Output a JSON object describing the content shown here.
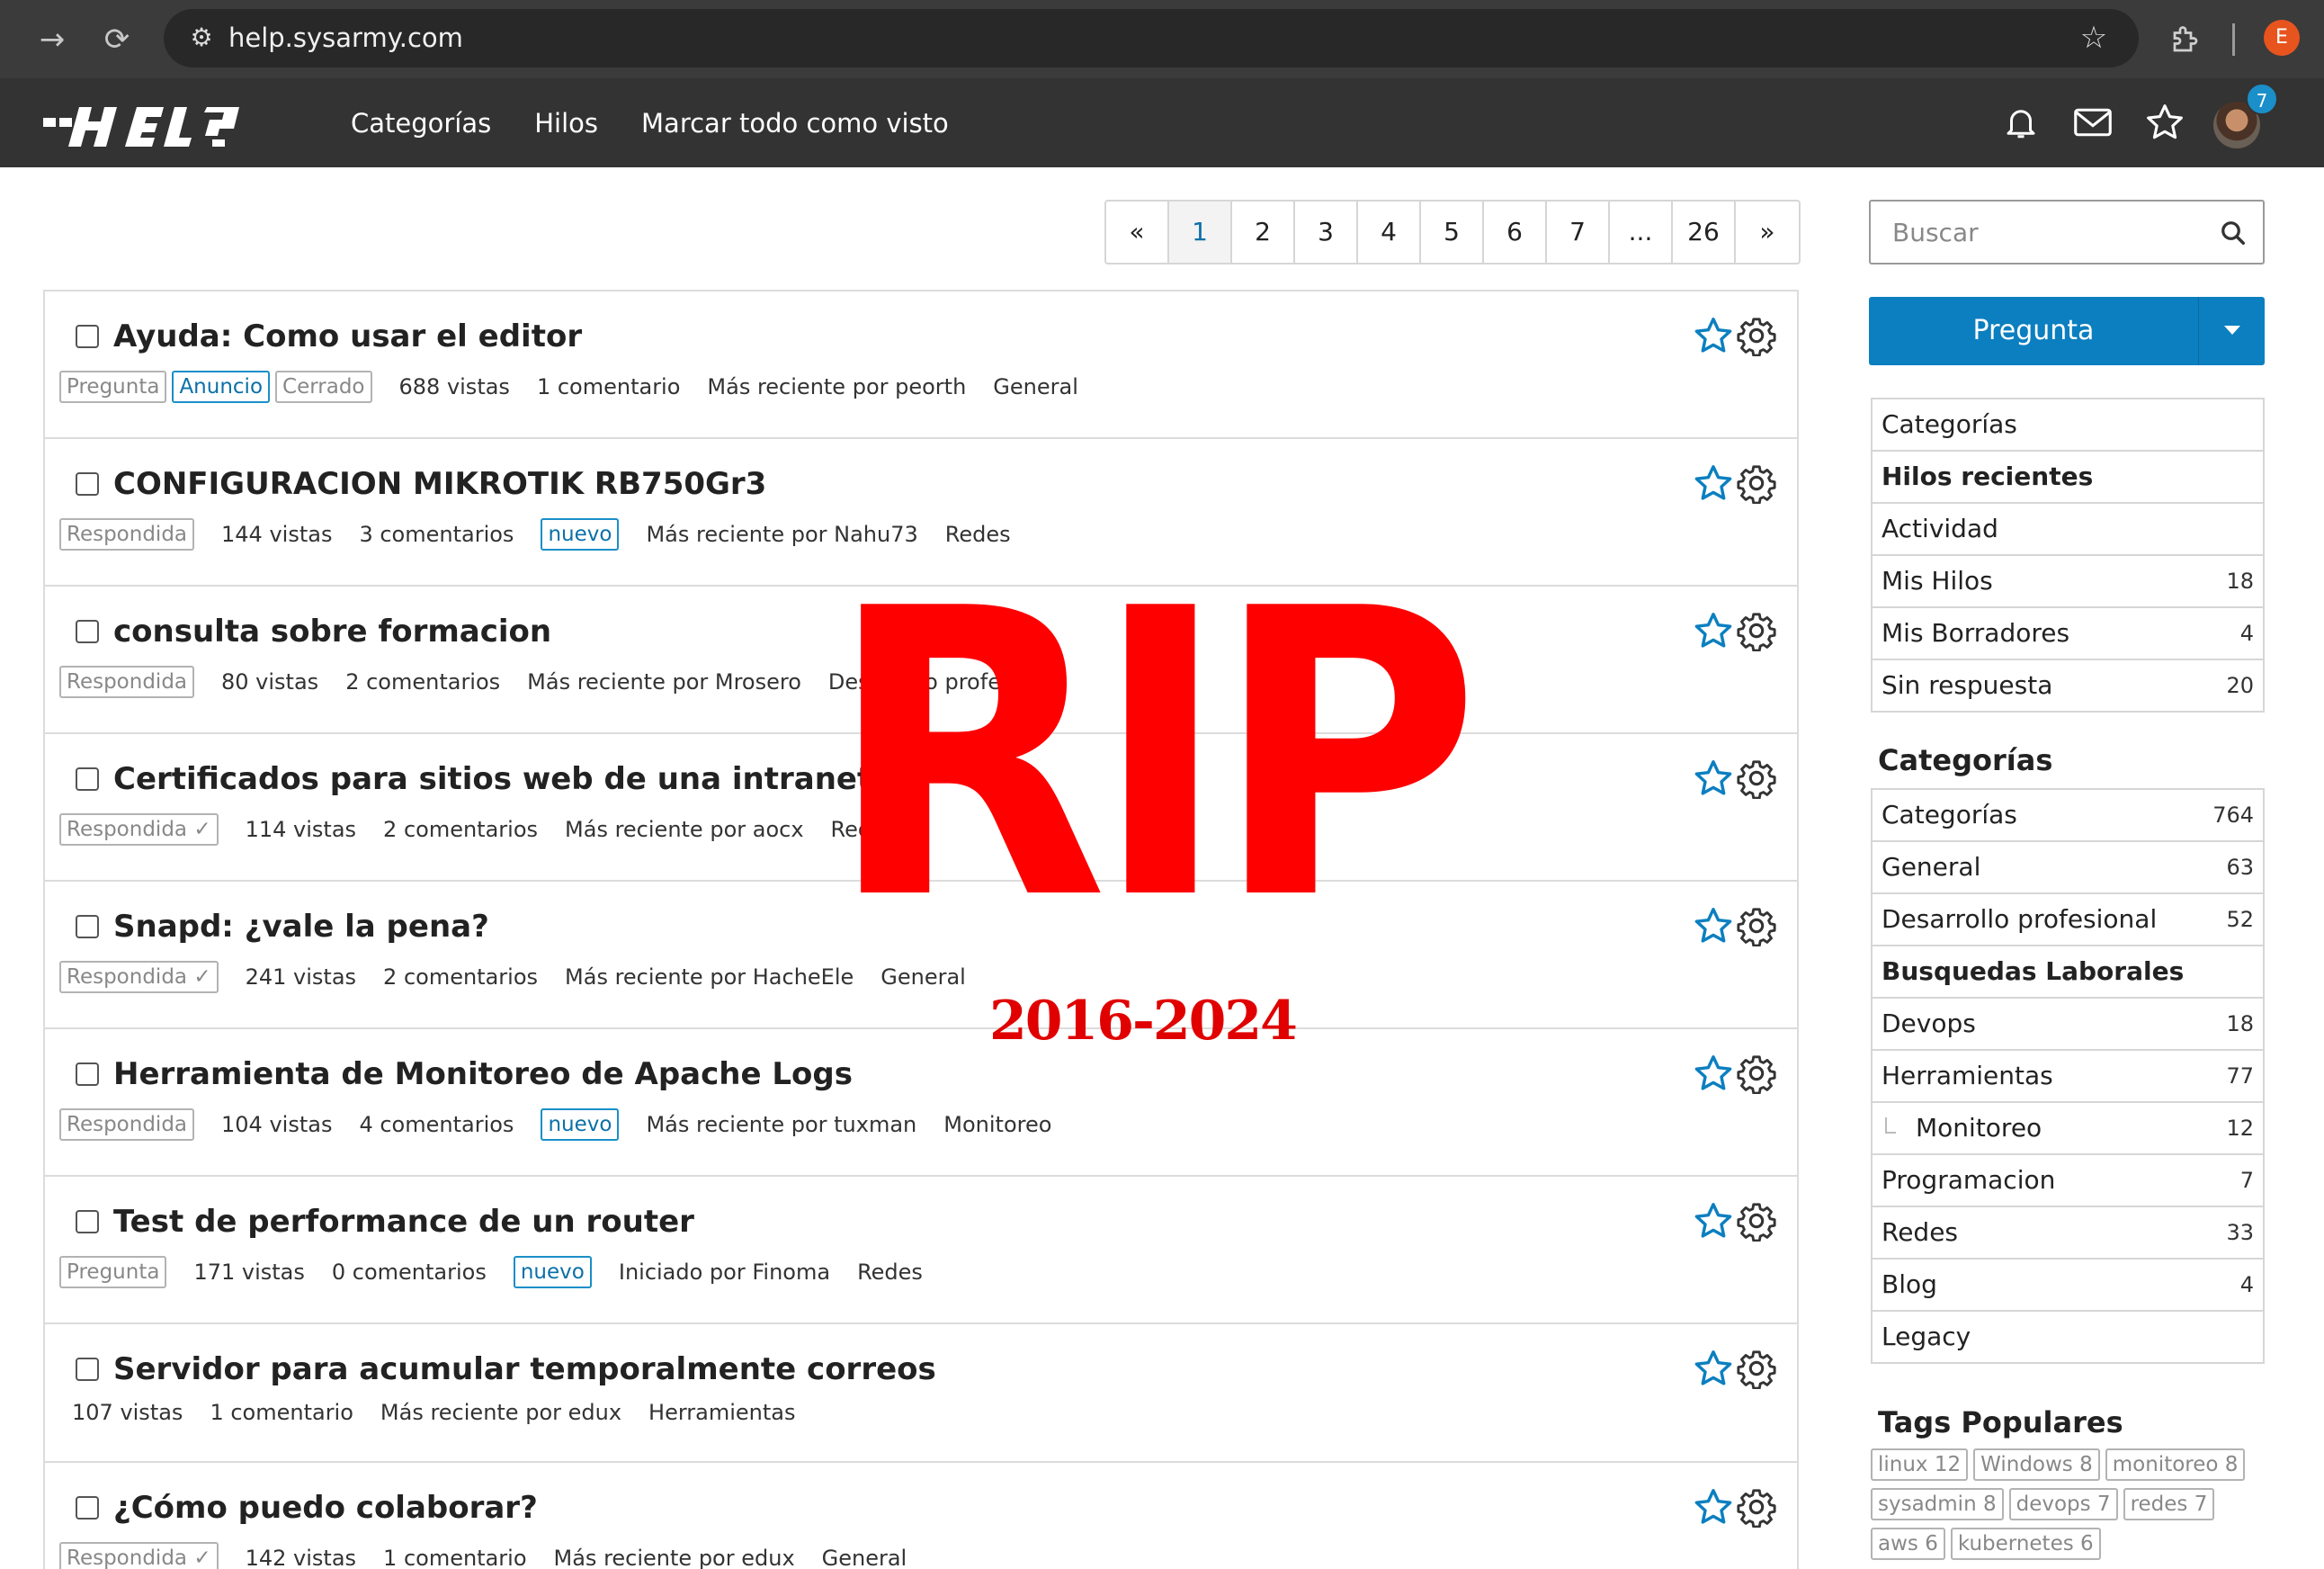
{
  "browser": {
    "url": "help.sysarmy.com",
    "profile_initial": "E"
  },
  "header": {
    "nav": [
      "Categorías",
      "Hilos",
      "Marcar todo como visto"
    ],
    "notification_count": "7"
  },
  "pager": [
    "«",
    "1",
    "2",
    "3",
    "4",
    "5",
    "6",
    "7",
    "...",
    "26",
    "»"
  ],
  "threads": [
    {
      "title": "Ayuda: Como usar el editor",
      "tags": [
        {
          "label": "Pregunta",
          "style": "gray"
        },
        {
          "label": "Anuncio",
          "style": "blue"
        },
        {
          "label": "Cerrado",
          "style": "gray"
        }
      ],
      "views": "688 vistas",
      "comments": "1 comentario",
      "badge": "",
      "latest": "Más reciente por peorth",
      "category": "General"
    },
    {
      "title": "CONFIGURACION MIKROTIK RB750Gr3",
      "tags": [
        {
          "label": "Respondida",
          "style": "gray"
        }
      ],
      "views": "144 vistas",
      "comments": "3 comentarios",
      "badge": "nuevo",
      "latest": "Más reciente por Nahu73",
      "category": "Redes"
    },
    {
      "title": "consulta sobre formacion",
      "tags": [
        {
          "label": "Respondida",
          "style": "gray"
        }
      ],
      "views": "80 vistas",
      "comments": "2 comentarios",
      "badge": "",
      "latest": "Más reciente por Mrosero",
      "category": "Desarrollo profesional"
    },
    {
      "title": "Certificados para sitios web de una intranet",
      "tags": [
        {
          "label": "Respondida ✓",
          "style": "gray"
        }
      ],
      "views": "114 vistas",
      "comments": "2 comentarios",
      "badge": "",
      "latest": "Más reciente por aocx",
      "category": "Redes"
    },
    {
      "title": "Snapd: ¿vale la pena?",
      "tags": [
        {
          "label": "Respondida ✓",
          "style": "gray"
        }
      ],
      "views": "241 vistas",
      "comments": "2 comentarios",
      "badge": "",
      "latest": "Más reciente por HacheEle",
      "category": "General"
    },
    {
      "title": "Herramienta de Monitoreo de Apache Logs",
      "tags": [
        {
          "label": "Respondida",
          "style": "gray"
        }
      ],
      "views": "104 vistas",
      "comments": "4 comentarios",
      "badge": "nuevo",
      "latest": "Más reciente por tuxman",
      "category": "Monitoreo"
    },
    {
      "title": "Test de performance de un router",
      "tags": [
        {
          "label": "Pregunta",
          "style": "gray"
        }
      ],
      "views": "171 vistas",
      "comments": "0 comentarios",
      "badge": "nuevo",
      "latest": "Iniciado por Finoma",
      "category": "Redes"
    },
    {
      "title": "Servidor para acumular temporalmente correos",
      "tags": [],
      "views": "107 vistas",
      "comments": "1 comentario",
      "badge": "",
      "latest": "Más reciente por edux",
      "category": "Herramientas"
    },
    {
      "title": "¿Cómo puedo colaborar?",
      "tags": [
        {
          "label": "Respondida ✓",
          "style": "gray"
        }
      ],
      "views": "142 vistas",
      "comments": "1 comentario",
      "badge": "",
      "latest": "Más reciente por edux",
      "category": "General"
    }
  ],
  "overlay": {
    "text": "RIP",
    "years": "2016-2024"
  },
  "sidebar": {
    "search_placeholder": "Buscar",
    "ask_label": "Pregunta",
    "menu": [
      {
        "label": "Categorías",
        "count": ""
      },
      {
        "label": "Hilos recientes",
        "count": "",
        "bold": true
      },
      {
        "label": "Actividad",
        "count": ""
      },
      {
        "label": "Mis Hilos",
        "count": "18"
      },
      {
        "label": "Mis Borradores",
        "count": "4"
      },
      {
        "label": "Sin respuesta",
        "count": "20"
      }
    ],
    "categories_heading": "Categorías",
    "categories": [
      {
        "label": "Categorías",
        "count": "764"
      },
      {
        "label": "General",
        "count": "63"
      },
      {
        "label": "Desarrollo profesional",
        "count": "52"
      },
      {
        "label": "Busquedas Laborales",
        "count": "",
        "bold": true
      },
      {
        "label": "Devops",
        "count": "18"
      },
      {
        "label": "Herramientas",
        "count": "77"
      },
      {
        "label": "Monitoreo",
        "count": "12",
        "sub": true
      },
      {
        "label": "Programacion",
        "count": "7"
      },
      {
        "label": "Redes",
        "count": "33"
      },
      {
        "label": "Blog",
        "count": "4"
      },
      {
        "label": "Legacy",
        "count": ""
      }
    ],
    "tags_heading": "Tags Populares",
    "popular_tags": [
      "linux 12",
      "Windows 8",
      "monitoreo 8",
      "sysadmin 8",
      "devops 7",
      "redes 7",
      "aws 6",
      "kubernetes 6"
    ]
  }
}
